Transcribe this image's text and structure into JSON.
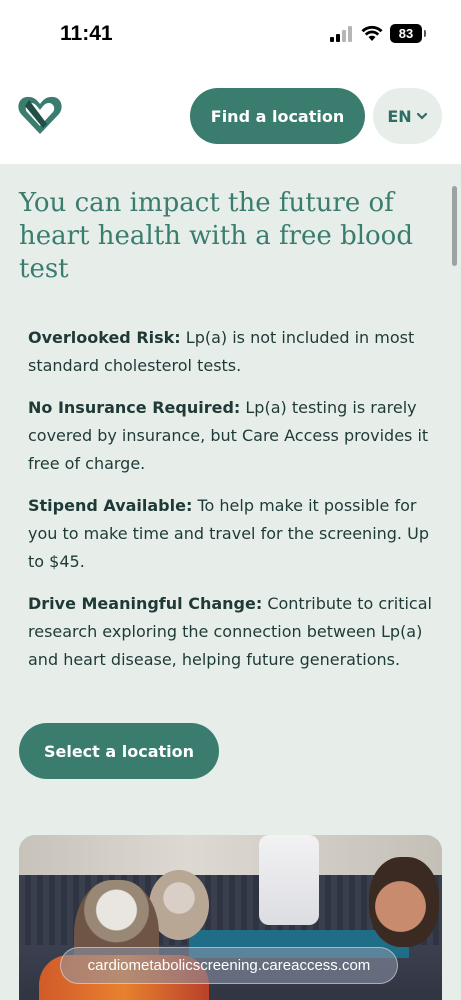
{
  "status_bar": {
    "time": "11:41",
    "battery": "83"
  },
  "header": {
    "logo_icon": "heart-logo-icon",
    "find_location_label": "Find a location",
    "language_label": "EN",
    "language_icon": "chevron-down-icon"
  },
  "main": {
    "headline": "You can impact the future of heart health with a free blood test",
    "benefits": [
      {
        "title": "Overlooked Risk:",
        "text": " Lp(a) is not included in most standard cholesterol tests."
      },
      {
        "title": "No Insurance Required:",
        "text": " Lp(a) testing is rarely covered by insurance, but Care Access provides it free of charge."
      },
      {
        "title": "Stipend Available:",
        "text": " To help make it possible for you to make time and travel for the screening. Up to $45."
      },
      {
        "title": "Drive Meaningful Change:",
        "text": " Contribute to critical research exploring the connection between Lp(a) and heart disease, helping future generations."
      }
    ],
    "select_location_label": "Select a location"
  },
  "browser": {
    "url": "cardiometabolicscreening.careaccess.com"
  },
  "colors": {
    "brand_green": "#3a7d6e",
    "page_background": "#e7eeea",
    "header_background": "#ffffff"
  }
}
